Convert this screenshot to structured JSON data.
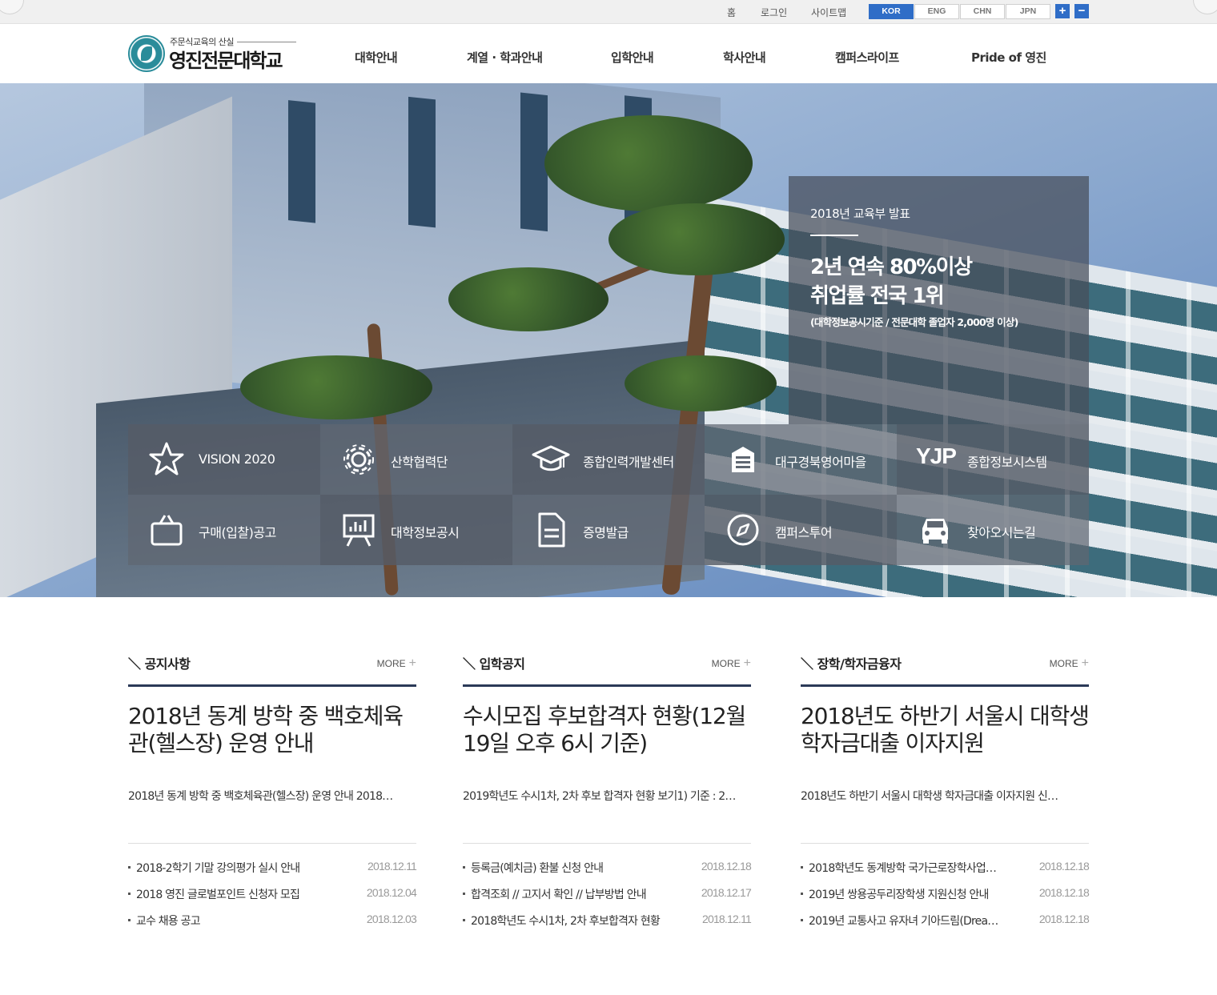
{
  "util": {
    "links": [
      "홈",
      "로그인",
      "사이트맵"
    ],
    "languages": [
      "KOR",
      "ENG",
      "CHN",
      "JPN"
    ],
    "active_language": "KOR",
    "zoom_in": "+",
    "zoom_out": "−"
  },
  "header": {
    "logo_sub": "주문식교육의 산실",
    "logo_name": "영진전문대학교",
    "nav": [
      "대학안내",
      "계열 · 학과안내",
      "입학안내",
      "학사안내",
      "캠퍼스라이프",
      "Pride of 영진"
    ]
  },
  "hero": {
    "kicker": "2018년 교육부 발표",
    "headline_1": "2년 연속 80%이상",
    "headline_2": "취업률 전국 1위",
    "note": "(대학정보공시기준 / 전문대학 졸업자 2,000명 이상)"
  },
  "quick_links": {
    "row1": [
      {
        "label": "VISION 2020",
        "icon": "star-icon"
      },
      {
        "label": "산학협력단",
        "icon": "gear-icon"
      },
      {
        "label": "종합인력개발센터",
        "icon": "graduation-cap-icon"
      },
      {
        "label": "대구경북영어마을",
        "icon": "building-icon"
      },
      {
        "label": "종합정보시스템",
        "icon": "yjp-text-icon",
        "icon_text": "YJP"
      }
    ],
    "row2": [
      {
        "label": "구매(입찰)공고",
        "icon": "bag-icon"
      },
      {
        "label": "대학정보공시",
        "icon": "presentation-board-icon"
      },
      {
        "label": "증명발급",
        "icon": "document-icon"
      },
      {
        "label": "캠퍼스투어",
        "icon": "compass-icon"
      },
      {
        "label": "찾아오시는길",
        "icon": "car-icon"
      }
    ]
  },
  "boards": [
    {
      "title": "공지사항",
      "more": "MORE",
      "featured_title": "2018년 동계 방학 중 백호체육관(헬스장) 운영 안내",
      "featured_summary": "2018년 동계 방학 중 백호체육관(헬스장) 운영 안내 2018…",
      "items": [
        {
          "title": "2018-2학기 기말 강의평가 실시 안내",
          "date": "2018.12.11"
        },
        {
          "title": "2018 영진 글로벌포인트 신청자 모집",
          "date": "2018.12.04"
        },
        {
          "title": "교수 채용 공고",
          "date": "2018.12.03"
        }
      ]
    },
    {
      "title": "입학공지",
      "more": "MORE",
      "featured_title": "수시모집 후보합격자 현황(12월19일 오후 6시 기준)",
      "featured_summary": "2019학년도 수시1차, 2차 후보 합격자 현황 보기1) 기준 : 2…",
      "items": [
        {
          "title": "등록금(예치금) 환불 신청 안내",
          "date": "2018.12.18"
        },
        {
          "title": "합격조회 // 고지서 확인 // 납부방법 안내",
          "date": "2018.12.17"
        },
        {
          "title": "2018학년도 수시1차, 2차 후보합격자 현황",
          "date": "2018.12.11"
        }
      ]
    },
    {
      "title": "장학/학자금융자",
      "more": "MORE",
      "featured_title": "2018년도 하반기 서울시 대학생 학자금대출 이자지원",
      "featured_summary": "2018년도 하반기 서울시 대학생 학자금대출 이자지원 신…",
      "items": [
        {
          "title": "2018학년도 동계방학 국가근로장학사업…",
          "date": "2018.12.18"
        },
        {
          "title": "2019년 쌍용공두리장학생 지원신청 안내",
          "date": "2018.12.18"
        },
        {
          "title": "2019년 교통사고 유자녀 기아드림(Drea…",
          "date": "2018.12.18"
        }
      ]
    }
  ],
  "colors": {
    "accent_blue": "#2f6dc7",
    "board_bar": "#2b3a58",
    "promo_bg": "#464e5a"
  }
}
